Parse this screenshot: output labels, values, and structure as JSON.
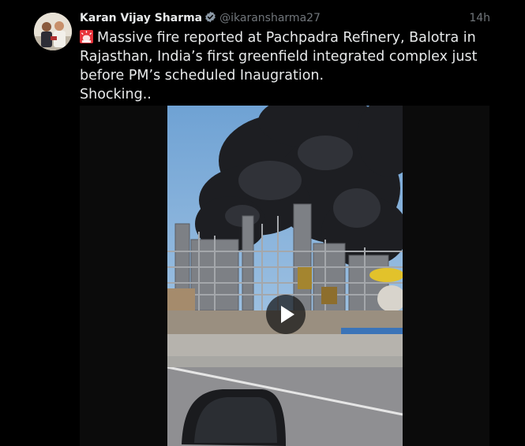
{
  "tweet": {
    "author_name": "Karan Vijay Sharma",
    "author_handle": "@ikaransharma27",
    "timestamp": "14h",
    "verified": true,
    "lines": [
      "Massive fire reported at Pachpadra Refinery, Balotra in",
      "Rajasthan, India’s first greenfield integrated complex just",
      "before PM’s scheduled Inaugration.",
      "Shocking.."
    ]
  },
  "icons": {
    "verified": "verified-badge-icon",
    "siren": "siren-emoji-icon",
    "play": "play-icon"
  },
  "colors": {
    "background": "#000000",
    "text": "#e7e9ea",
    "muted": "#71767b",
    "verified": "#8b98a5"
  }
}
